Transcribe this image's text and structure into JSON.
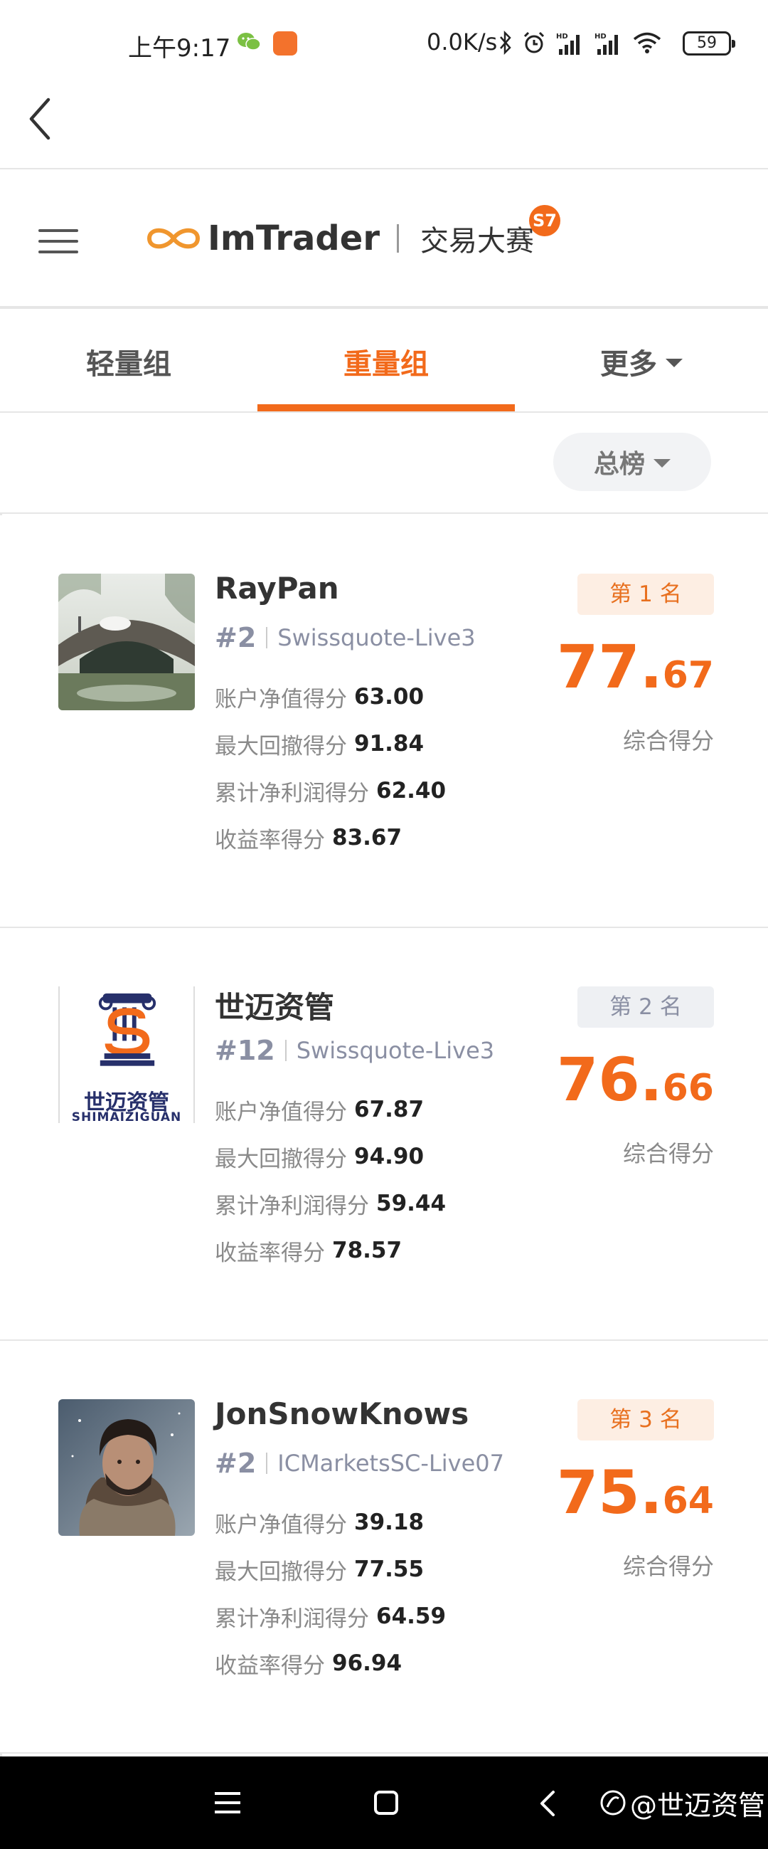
{
  "status_bar": {
    "time": "上午9:17",
    "network_speed": "0.0K/s",
    "battery": "59"
  },
  "header": {
    "logo_name": "ImTrader",
    "logo_sub": "交易大赛",
    "season_badge": "S7"
  },
  "tabs": {
    "light": "轻量组",
    "heavy": "重量组",
    "more": "更多",
    "active": "heavy"
  },
  "filter": {
    "label": "总榜"
  },
  "rankings": [
    {
      "name": "RayPan",
      "rank_id": "#2",
      "server": "Swissquote-Live3",
      "stats": [
        {
          "label": "账户净值得分",
          "value": "63.00"
        },
        {
          "label": "最大回撤得分",
          "value": "91.84"
        },
        {
          "label": "累计净利润得分",
          "value": "62.40"
        },
        {
          "label": "收益率得分",
          "value": "83.67"
        }
      ],
      "place": "第 1 名",
      "score_int": "77.",
      "score_dec": "67",
      "score_label": "综合得分"
    },
    {
      "name": "世迈资管",
      "rank_id": "#12",
      "server": "Swissquote-Live3",
      "avatar_text": "世迈资管",
      "avatar_subtext": "SHIMAIZIGUAN",
      "stats": [
        {
          "label": "账户净值得分",
          "value": "67.87"
        },
        {
          "label": "最大回撤得分",
          "value": "94.90"
        },
        {
          "label": "累计净利润得分",
          "value": "59.44"
        },
        {
          "label": "收益率得分",
          "value": "78.57"
        }
      ],
      "place": "第 2 名",
      "score_int": "76.",
      "score_dec": "66",
      "score_label": "综合得分"
    },
    {
      "name": "JonSnowKnows",
      "rank_id": "#2",
      "server": "ICMarketsSC-Live07",
      "stats": [
        {
          "label": "账户净值得分",
          "value": "39.18"
        },
        {
          "label": "最大回撤得分",
          "value": "77.55"
        },
        {
          "label": "累计净利润得分",
          "value": "64.59"
        },
        {
          "label": "收益率得分",
          "value": "96.94"
        }
      ],
      "place": "第 3 名",
      "score_int": "75.",
      "score_dec": "64",
      "score_label": "综合得分"
    }
  ],
  "watermark": "@世迈资管",
  "colors": {
    "accent": "#f26a1b",
    "muted": "#8a8fa3",
    "divider": "#e6e6e6"
  }
}
